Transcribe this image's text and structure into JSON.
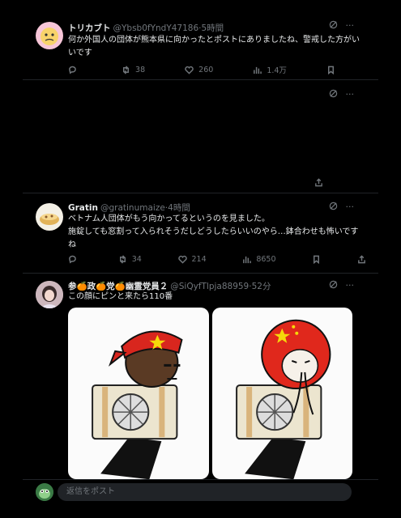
{
  "posts": [
    {
      "display_name": "トリカブト",
      "handle": "@Ybsb0fYndY47186",
      "dot": "·",
      "time": "5時間",
      "text": "何か外国人の団体が熊本県に向かったとポストにありましたね、警戒した方がいいです",
      "replies": "",
      "reposts": "38",
      "likes": "260",
      "views": "1.4万"
    },
    {
      "display_name": "Gratin",
      "handle": "@gratinumaize",
      "dot": "·",
      "time": "4時間",
      "text_line1": "ベトナム人団体がもう向かってるというのを見ました。",
      "text_line2": "施錠しても窓割って入られそうだしどうしたらいいのやら…鉢合わせも怖いですね",
      "replies": "",
      "reposts": "34",
      "likes": "214",
      "views": "8650"
    },
    {
      "display_name": "参🍊政🍊党🍊幽霊党員２",
      "handle": "@SiQyfTlpja88959",
      "dot": "·",
      "time": "52分",
      "text": "この顔にピンと来たら110番"
    }
  ],
  "reply_placeholder": "返信をポスト",
  "icons": [
    "grok-icon",
    "more-icon",
    "reply-icon",
    "repost-icon",
    "like-icon",
    "views-icon",
    "bookmark-icon",
    "share-icon"
  ]
}
